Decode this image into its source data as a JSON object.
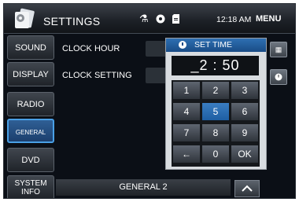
{
  "header": {
    "title": "SETTINGS",
    "time": "12:18 AM",
    "menu_label": "MENU",
    "status_icons": [
      "usb-icon",
      "disc-icon",
      "sd-card-icon"
    ]
  },
  "sidebar": {
    "items": [
      {
        "label": "SOUND"
      },
      {
        "label": "DISPLAY"
      },
      {
        "label": "RADIO"
      },
      {
        "label": "GENERAL",
        "active": true
      },
      {
        "label": "DVD"
      },
      {
        "label_line1": "SYSTEM",
        "label_line2": "INFO"
      }
    ]
  },
  "settings": {
    "clock_hour_label": "CLOCK HOUR",
    "clock_setting_label": "CLOCK SETTING"
  },
  "set_time_dialog": {
    "title": "SET TIME",
    "display_value": "_2 : 50",
    "keys": [
      "1",
      "2",
      "3",
      "4",
      "5",
      "6",
      "7",
      "8",
      "9",
      "←",
      "0",
      "OK"
    ],
    "selected_key": "5"
  },
  "footer": {
    "page_label": "GENERAL 2"
  },
  "colors": {
    "accent": "#2e6fb2",
    "background": "#0b0f16"
  }
}
